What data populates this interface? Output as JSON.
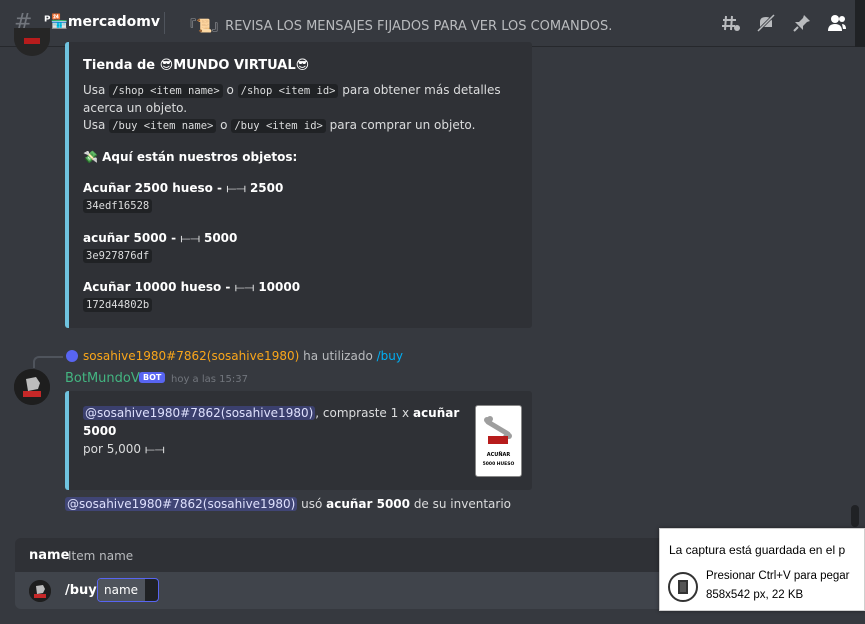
{
  "header": {
    "channel_name": "ᴾ🏪mercadomv",
    "topic": "『📜』REVISA LOS MENSAJES FIJADOS PARA VER LOS COMANDOS.",
    "icons": [
      "threads-icon",
      "mute-icon",
      "pin-icon",
      "members-icon"
    ]
  },
  "shop_embed": {
    "title": "Tienda de 😎MUNDO VIRTUAL😎",
    "desc_1a": "Usa ",
    "code_1": "/shop <item name>",
    "desc_1b": " o ",
    "code_2": "/shop <item id>",
    "desc_1c": " para obtener más detalles acerca un objeto.",
    "desc_2a": "Usa ",
    "code_3": "/buy <item name>",
    "desc_2b": " o ",
    "code_4": "/buy <item id>",
    "desc_2c": " para comprar un objeto.",
    "subtitle": "💸 Aquí están nuestros objetos:",
    "items": [
      {
        "name": "Acuñar 2500 hueso - ",
        "price": "2500",
        "id": "34edf16528"
      },
      {
        "name": "acuñar 5000 - ",
        "price": "5000",
        "id": "3e927876df"
      },
      {
        "name": "Acuñar 10000 hueso - ",
        "price": "10000",
        "id": "172d44802b"
      }
    ]
  },
  "reply": {
    "user": "sosahive1980#7862(sosahive1980)",
    "action": " ha utilizado ",
    "command": "/buy"
  },
  "message": {
    "author": "BotMundoV",
    "bot_tag": "BOT",
    "timestamp": "hoy a las 15:37"
  },
  "purchase_embed": {
    "mention": "@sosahive1980#7862(sosahive1980)",
    "text_a": ", compraste 1 x ",
    "item": "acuñar 5000",
    "text_b": "por 5,000",
    "thumb_label_1": "ACUÑAR",
    "thumb_label_2": "5000 HUESO"
  },
  "usage_line": {
    "mention": "@sosahive1980#7862(sosahive1980)",
    "text_a": " usó ",
    "item": "acuñar 5000",
    "text_b": " de su inventario"
  },
  "option_bar": {
    "name": "name",
    "description": "Item name"
  },
  "input": {
    "command": "/buy",
    "field_label": "name"
  },
  "toast": {
    "title": "La captura está guardada en el p",
    "line1": "Presionar Ctrl+V para pegar",
    "line2": "858x542 px, 22 KB"
  },
  "colors": {
    "background": "#36393f",
    "embed_bg": "#2f3136",
    "embed_border": "#6fc3df",
    "bot_name": "#43b581",
    "blurple": "#5865f2",
    "reply_user": "#faa61a",
    "command_link": "#00aff4"
  }
}
